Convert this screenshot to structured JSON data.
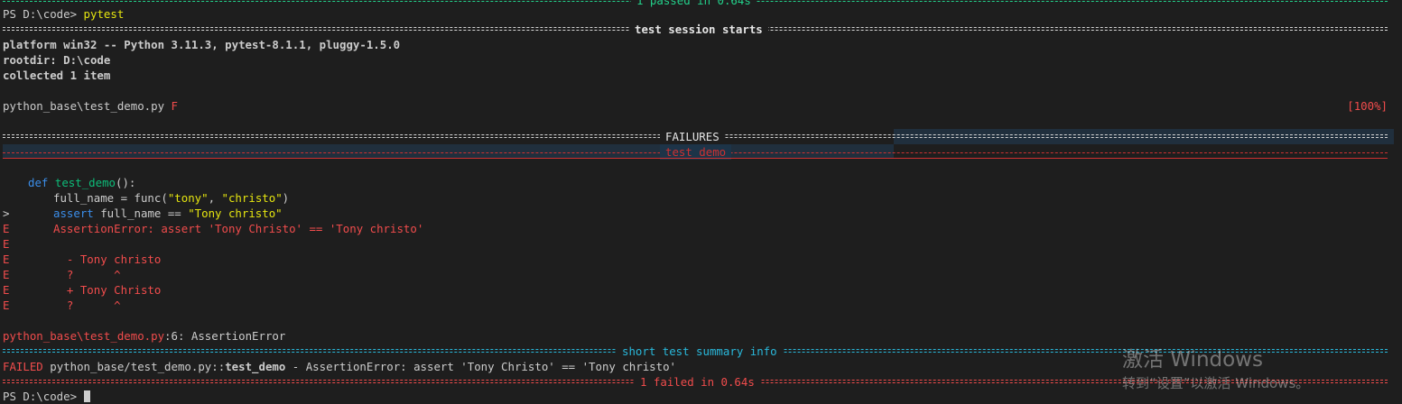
{
  "session": {
    "top_summary": "1 passed in 0.64s",
    "prompt": "PS D:\\code>",
    "command": "pytest",
    "header": "test session starts",
    "platform": "platform win32 -- Python 3.11.3, pytest-8.1.1, pluggy-1.5.0",
    "rootdir": "rootdir: D:\\code",
    "collected": "collected 1 item"
  },
  "progress": {
    "file": "python_base\\test_demo.py",
    "status": "F",
    "percent": "[100%]"
  },
  "failures": {
    "header": "FAILURES",
    "test_name": "test_demo",
    "code": {
      "def_kw": "def",
      "func_name": "test_demo",
      "def_tail": "():",
      "line2_pre": "full_name = func(",
      "arg1": "\"tony\"",
      "comma": ", ",
      "arg2": "\"christo\"",
      "line2_post": ")",
      "marker": ">",
      "assert_kw": "assert",
      "assert_mid": " full_name == ",
      "assert_str": "\"Tony christo\""
    },
    "error_lines": [
      {
        "prefix": "E",
        "text": "AssertionError: assert 'Tony Christo' == 'Tony christo'"
      },
      {
        "prefix": "E",
        "text": ""
      },
      {
        "prefix": "E",
        "text": "  - Tony christo"
      },
      {
        "prefix": "E",
        "text": "  ?      ^"
      },
      {
        "prefix": "E",
        "text": "  + Tony Christo"
      },
      {
        "prefix": "E",
        "text": "  ?      ^"
      }
    ],
    "location_file": "python_base\\test_demo.py",
    "location_line": ":6: ",
    "location_error": "AssertionError"
  },
  "summary": {
    "header": "short test summary info",
    "failed_tag": "FAILED",
    "failed_path": "python_base/test_demo.py::",
    "failed_test": "test_demo",
    "failed_msg": " - AssertionError: assert 'Tony Christo' == 'Tony christo'",
    "result": "1 failed in 0.64s"
  },
  "final_prompt": "PS D:\\code>",
  "watermark": {
    "title": "激活 Windows",
    "subtitle": "转到“设置”以激活 Windows。"
  },
  "colors": {
    "background": "#1e1e1e",
    "foreground": "#cccccc",
    "pass_green": "#23d18b",
    "fail_red": "#f14c4c",
    "string_yellow": "#e5e510",
    "info_cyan": "#29b8db",
    "keyword_blue": "#3b8eea"
  }
}
